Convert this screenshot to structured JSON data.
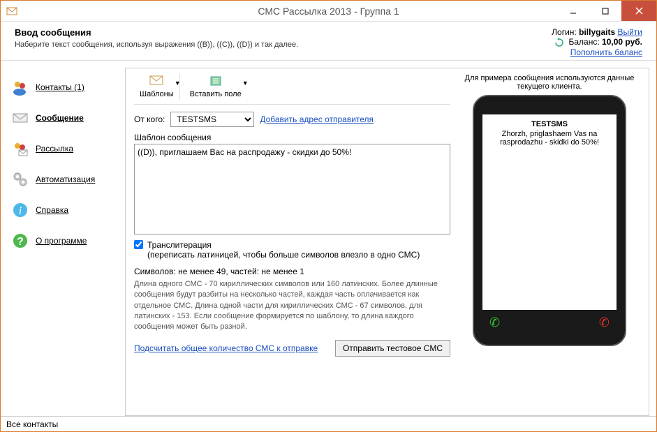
{
  "window": {
    "title": "СМС Рассылка 2013 - Группа 1"
  },
  "header": {
    "title": "Ввод сообщения",
    "subtitle": "Наберите текст сообщения, используя выражения ((B)), ((C)), ((D)) и так далее.",
    "login_label": "Логин:",
    "login_value": "billygaits",
    "logout": "Выйти",
    "balance_label": "Баланс:",
    "balance_value": "10,00 руб.",
    "topup": "Пополнить баланс"
  },
  "sidebar": {
    "items": [
      {
        "label": "Контакты (1)"
      },
      {
        "label": "Сообщение"
      },
      {
        "label": "Рассылка"
      },
      {
        "label": "Автоматизация"
      },
      {
        "label": "Справка"
      },
      {
        "label": "О программе"
      }
    ]
  },
  "toolbar": {
    "templates": "Шаблоны",
    "insert_field": "Вставить поле"
  },
  "from": {
    "label": "От кого:",
    "value": "TESTSMS",
    "add_sender": "Добавить адрес отправителя"
  },
  "template": {
    "label": "Шаблон сообщения",
    "text": "((D)), приглашаем Вас на распродажу - скидки до 50%!"
  },
  "translit": {
    "label": "Транслитерация",
    "desc": "(переписать латиницей, чтобы больше символов влезло в одно СМС)",
    "checked": true
  },
  "stats": "Символов: не менее 49, частей: не менее 1",
  "hint": "Длина одного СМС - 70 кириллических символов или 160 латинских. Более длинные сообщения будут разбиты на несколько частей, каждая часть оплачивается как отдельное СМС. Длина одной части для кириллических СМС - 67 символов, для латинских - 153. Если сообщение формируется по шаблону, то длина каждого сообщения может быть разной.",
  "count_link": "Подсчитать общее количество СМС к отправке",
  "send_test": "Отправить тестовое СМС",
  "phone": {
    "hint": "Для примера сообщения используются данные текущего клиента.",
    "sender": "TESTSMS",
    "body": "Zhorzh, priglashaem Vas na rasprodazhu - skidki do 50%!"
  },
  "statusbar": "Все контакты"
}
